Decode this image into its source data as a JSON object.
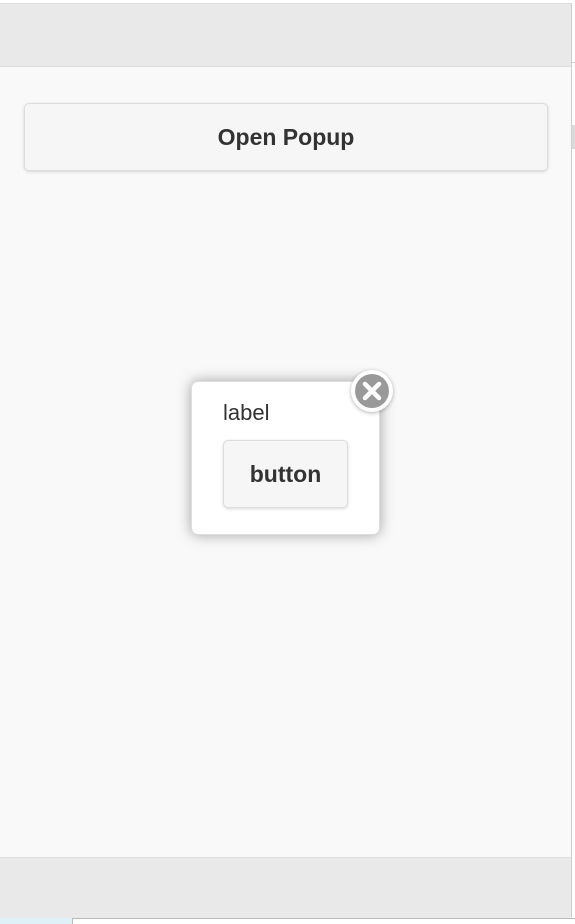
{
  "main": {
    "open_popup_label": "Open Popup"
  },
  "popup": {
    "label": "label",
    "button_label": "button",
    "close_icon": "close-circle-icon"
  },
  "colors": {
    "page_background": "#f9f9f9",
    "bar_background": "#e9e9e9",
    "button_background": "#f6f6f6",
    "text": "#333333",
    "close_icon": "#999999"
  }
}
